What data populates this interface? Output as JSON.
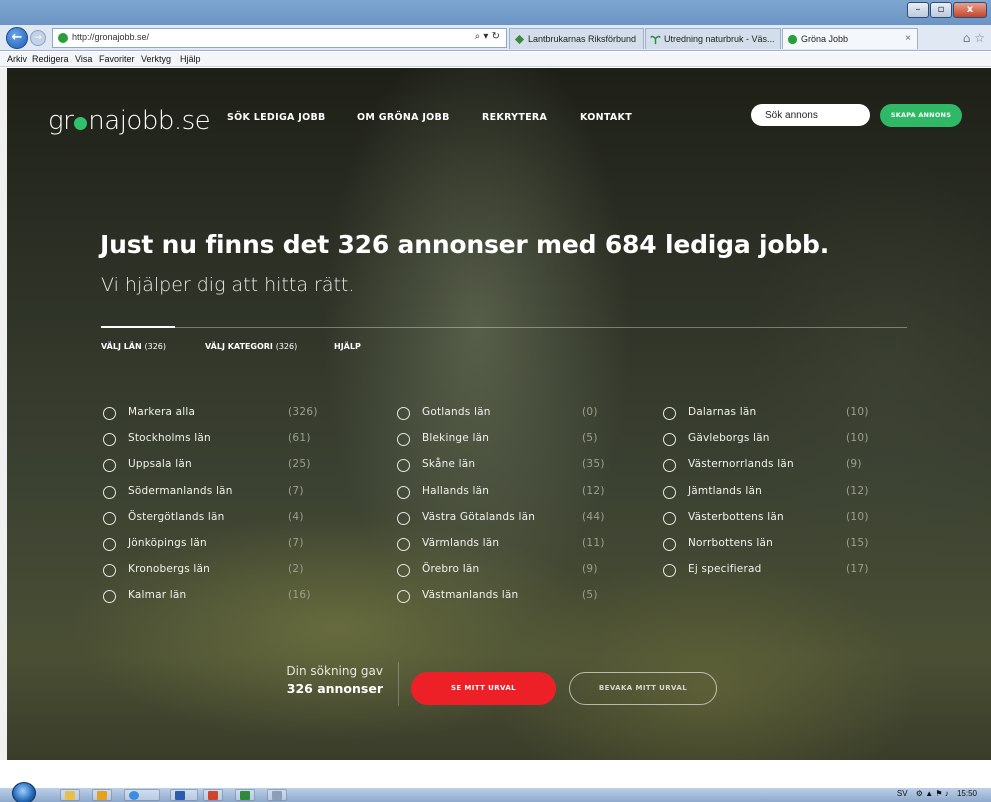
{
  "browser": {
    "url": "http://gronajobb.se/",
    "tabs": [
      {
        "label": "Lantbrukarnas Riksförbund"
      },
      {
        "label": "Utredning naturbruk - Väs..."
      },
      {
        "label": "Gröna Jobb"
      }
    ],
    "close_glyph": "×",
    "menu": [
      "Arkiv",
      "Redigera",
      "Visa",
      "Favoriter",
      "Verktyg",
      "Hjälp"
    ],
    "search_glyph": "⌕ ▾ ↻"
  },
  "site": {
    "logo_pre": "gr",
    "logo_post": "najobb.se",
    "nav": [
      "SÖK LEDIGA JOBB",
      "OM GRÖNA JOBB",
      "REKRYTERA",
      "KONTAKT"
    ],
    "search_placeholder": "Sök annons",
    "create_label": "SKAPA ANNONS",
    "brand_color": "#2fb866",
    "accent_red": "#ee2027"
  },
  "hero": {
    "headline": "Just nu finns det 326 annonser med 684 lediga jobb.",
    "subline": "Vi hjälper dig att hitta rätt."
  },
  "filters": {
    "tabs": [
      {
        "label": "VÄLJ LÄN",
        "count": "(326)"
      },
      {
        "label": "VÄLJ KATEGORI",
        "count": "(326)"
      },
      {
        "label": "HJÄLP",
        "count": ""
      }
    ],
    "columns": [
      [
        {
          "name": "Markera alla",
          "count": "(326)"
        },
        {
          "name": "Stockholms län",
          "count": "(61)"
        },
        {
          "name": "Uppsala län",
          "count": "(25)"
        },
        {
          "name": "Södermanlands län",
          "count": "(7)"
        },
        {
          "name": "Östergötlands län",
          "count": "(4)"
        },
        {
          "name": "Jönköpings län",
          "count": "(7)"
        },
        {
          "name": "Kronobergs län",
          "count": "(2)"
        },
        {
          "name": "Kalmar län",
          "count": "(16)"
        }
      ],
      [
        {
          "name": "Gotlands län",
          "count": "(0)"
        },
        {
          "name": "Blekinge län",
          "count": "(5)"
        },
        {
          "name": "Skåne län",
          "count": "(35)"
        },
        {
          "name": "Hallands län",
          "count": "(12)"
        },
        {
          "name": "Västra Götalands län",
          "count": "(44)"
        },
        {
          "name": "Värmlands län",
          "count": "(11)"
        },
        {
          "name": "Örebro län",
          "count": "(9)"
        },
        {
          "name": "Västmanlands län",
          "count": "(5)"
        }
      ],
      [
        {
          "name": "Dalarnas län",
          "count": "(10)"
        },
        {
          "name": "Gävleborgs län",
          "count": "(10)"
        },
        {
          "name": "Västernorrlands län",
          "count": "(9)"
        },
        {
          "name": "Jämtlands län",
          "count": "(12)"
        },
        {
          "name": "Västerbottens län",
          "count": "(10)"
        },
        {
          "name": "Norrbottens län",
          "count": "(15)"
        },
        {
          "name": "Ej specifierad",
          "count": "(17)"
        }
      ]
    ]
  },
  "result": {
    "line1": "Din sökning gav",
    "line2": "326 annonser",
    "primary_button": "SE MITT URVAL",
    "secondary_button": "BEVAKA MITT URVAL"
  },
  "taskbar": {
    "language": "SV",
    "clock": "15:50"
  }
}
